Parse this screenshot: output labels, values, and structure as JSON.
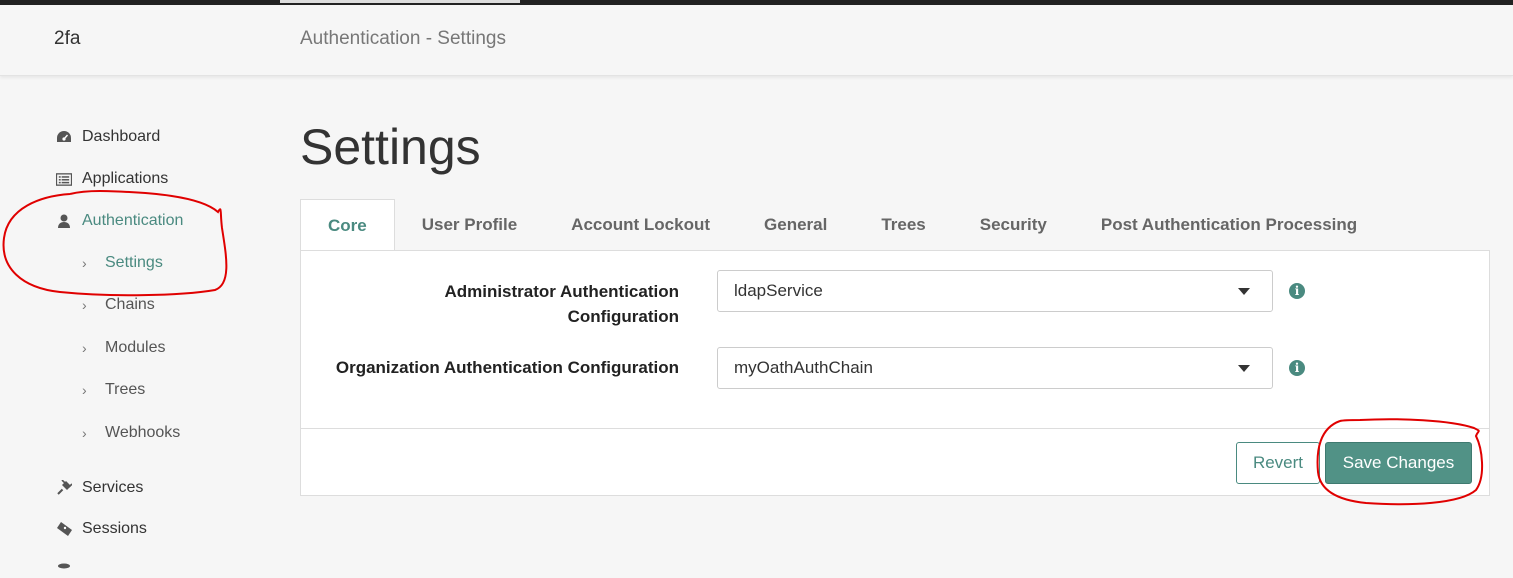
{
  "header": {
    "realm": "2fa",
    "breadcrumb": "Authentication - Settings"
  },
  "sidebar": {
    "items": [
      {
        "label": "Dashboard",
        "icon": "dashboard-icon"
      },
      {
        "label": "Applications",
        "icon": "applications-icon"
      },
      {
        "label": "Authentication",
        "icon": "user-icon",
        "active": true
      },
      {
        "label": "Services",
        "icon": "plug-icon"
      },
      {
        "label": "Sessions",
        "icon": "ticket-icon"
      }
    ],
    "subitems": [
      {
        "label": "Settings",
        "active": true
      },
      {
        "label": "Chains"
      },
      {
        "label": "Modules"
      },
      {
        "label": "Trees"
      },
      {
        "label": "Webhooks"
      }
    ]
  },
  "main": {
    "title": "Settings",
    "tabs": [
      {
        "label": "Core",
        "active": true
      },
      {
        "label": "User Profile"
      },
      {
        "label": "Account Lockout"
      },
      {
        "label": "General"
      },
      {
        "label": "Trees"
      },
      {
        "label": "Security"
      },
      {
        "label": "Post Authentication Processing"
      }
    ],
    "fields": {
      "admin_label_line1": "Administrator Authentication",
      "admin_label_line2": "Configuration",
      "admin_value": "ldapService",
      "org_label": "Organization Authentication Configuration",
      "org_value": "myOathAuthChain"
    },
    "buttons": {
      "revert": "Revert",
      "save": "Save Changes"
    }
  },
  "colors": {
    "accent": "#4a8a80",
    "save_button": "#519286",
    "annotation": "#e00000"
  }
}
